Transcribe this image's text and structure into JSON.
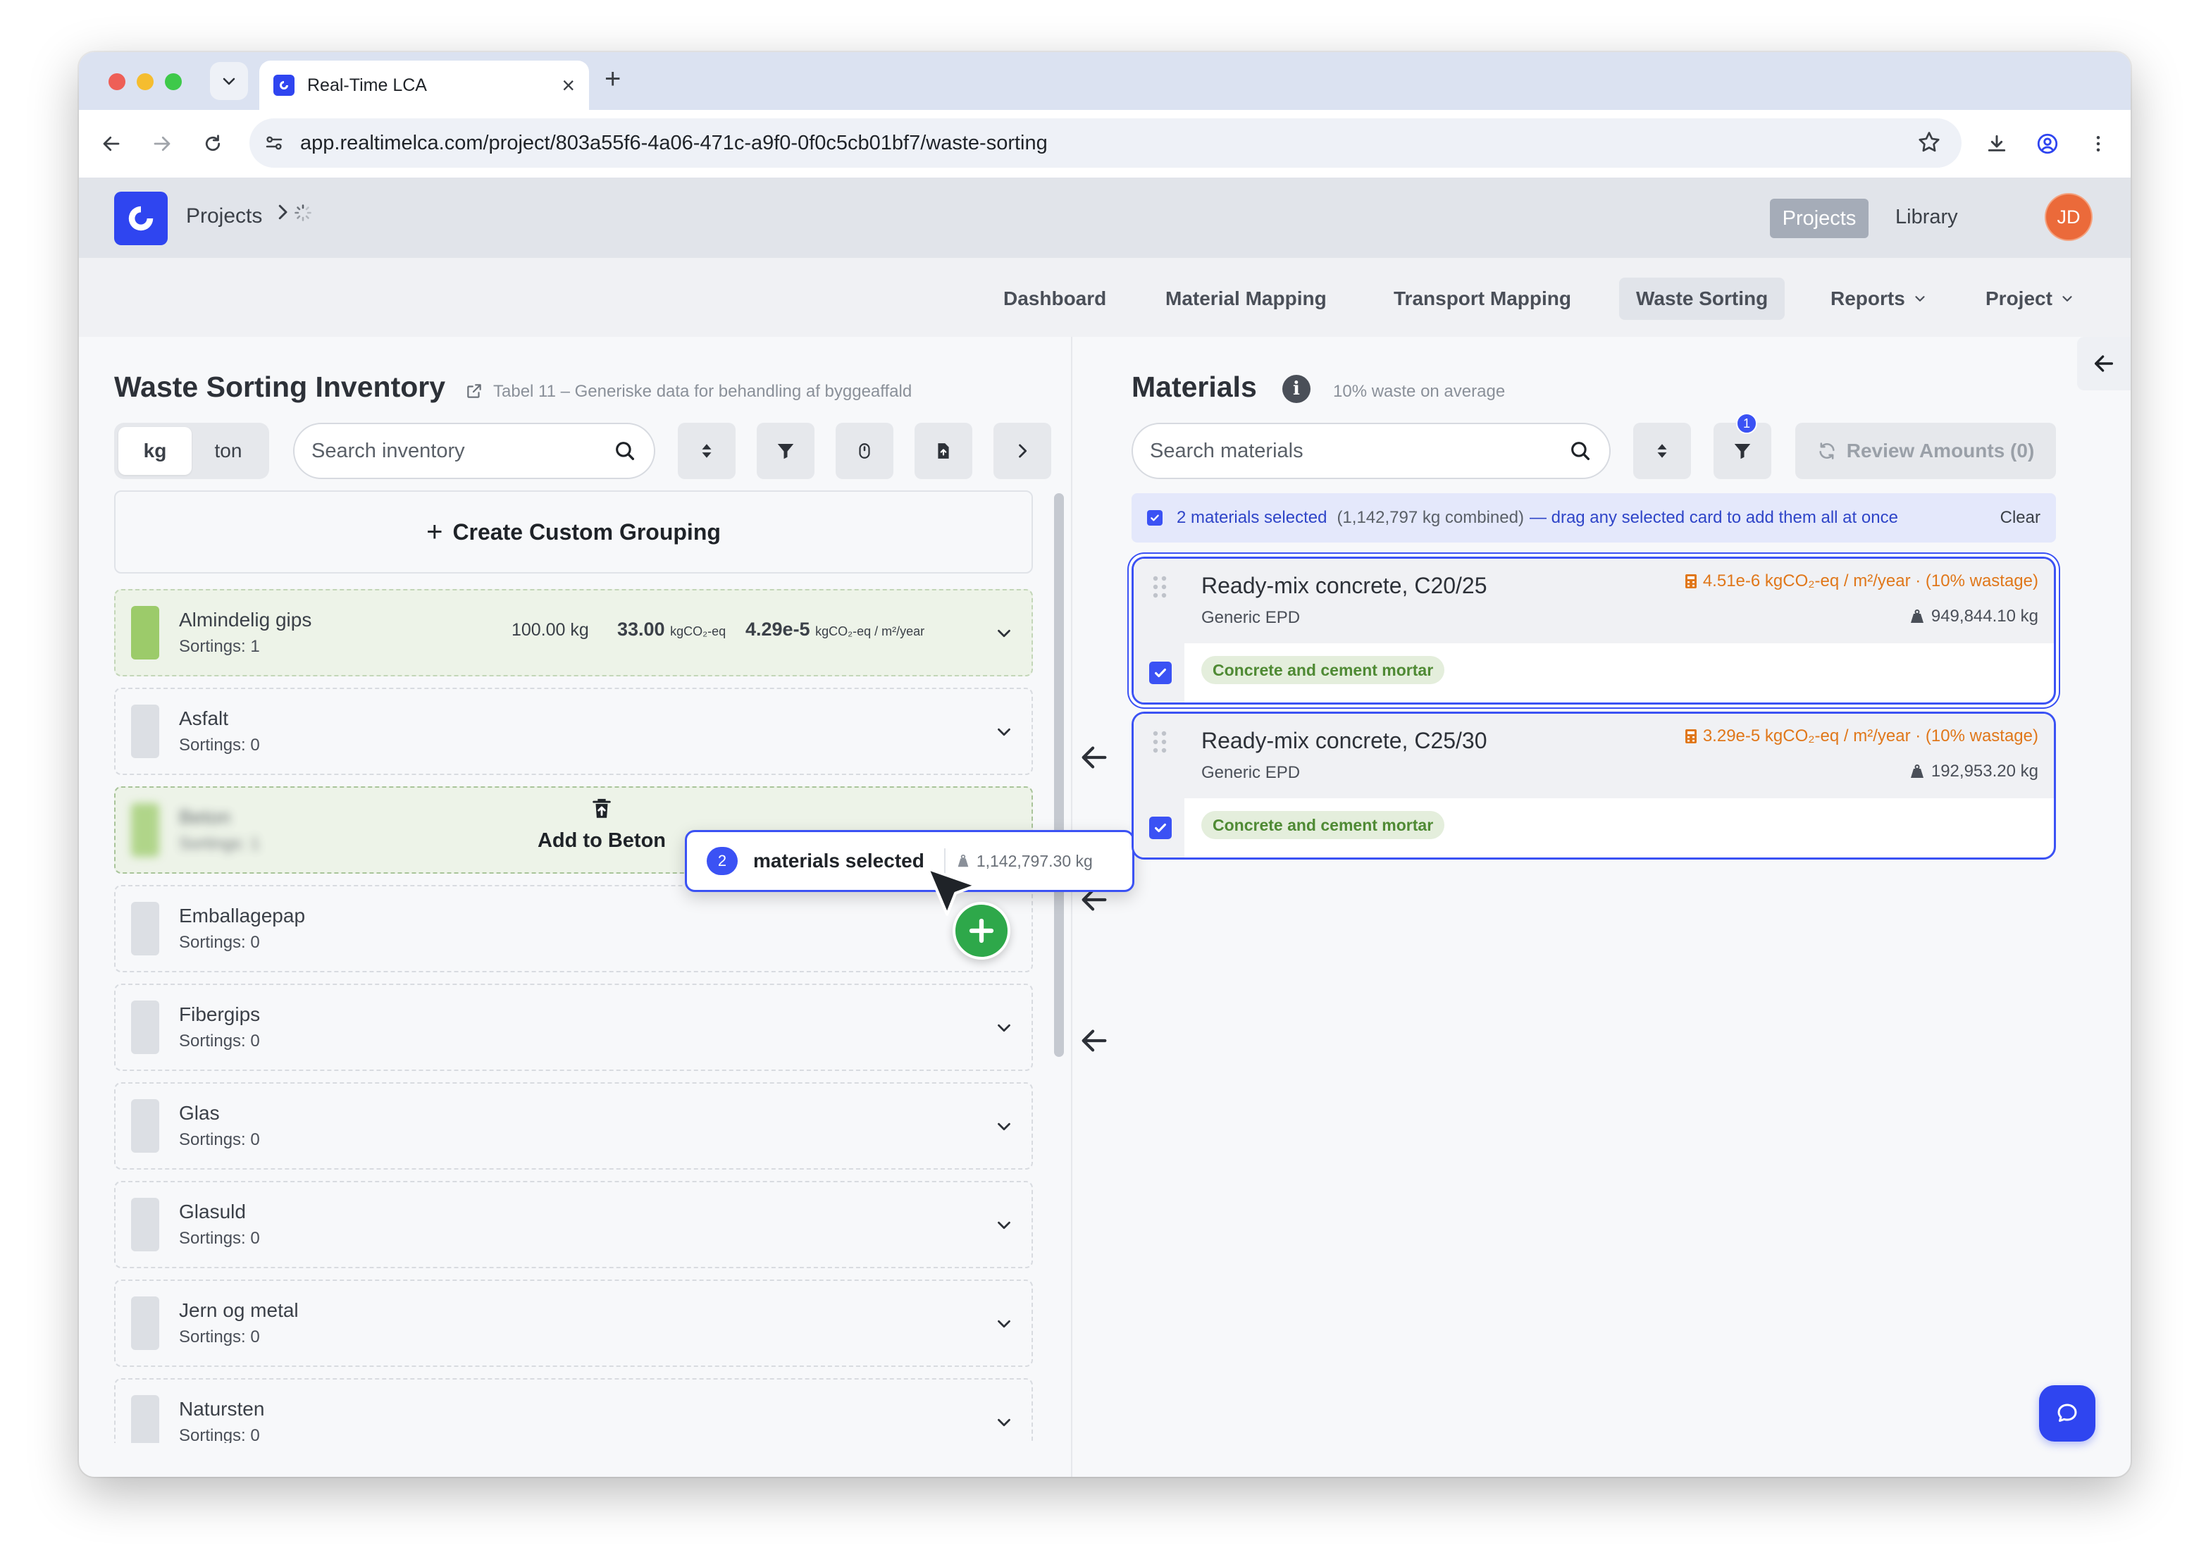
{
  "browser": {
    "tab_title": "Real-Time LCA",
    "url": "app.realtimelca.com/project/803a55f6-4a06-471c-a9f0-0f0c5cb01bf7/waste-sorting"
  },
  "header": {
    "breadcrumb_root": "Projects",
    "projects_button": "Projects",
    "library_link": "Library",
    "avatar_initials": "JD",
    "brand_color": "#2f45f0",
    "avatar_color": "#eb6a3a"
  },
  "nav": {
    "dashboard": "Dashboard",
    "material_mapping": "Material Mapping",
    "transport_mapping": "Transport Mapping",
    "waste_sorting": "Waste Sorting",
    "reports": "Reports",
    "project": "Project"
  },
  "inventory": {
    "title": "Waste Sorting Inventory",
    "source_link": "Tabel 11 – Generiske data for behandling af byggeaffald",
    "unit_kg": "kg",
    "unit_ton": "ton",
    "search_placeholder": "Search inventory",
    "create_grouping": "Create Custom Grouping",
    "drop_target_label": "Add to Beton",
    "groups": [
      {
        "name": "Almindelig gips",
        "sortings": "Sortings: 1",
        "amount": "100.00 kg",
        "co2_value": "33.00",
        "co2_unit": "kgCO₂-eq",
        "intensity_value": "4.29e-5",
        "intensity_unit": "kgCO₂-eq / m²/year"
      },
      {
        "name": "Asfalt",
        "sortings": "Sortings: 0"
      },
      {
        "name": "Beton",
        "sortings": "Sortings: 1"
      },
      {
        "name": "Emballagepap",
        "sortings": "Sortings: 0"
      },
      {
        "name": "Fibergips",
        "sortings": "Sortings: 0"
      },
      {
        "name": "Glas",
        "sortings": "Sortings: 0"
      },
      {
        "name": "Glasuld",
        "sortings": "Sortings: 0"
      },
      {
        "name": "Jern og metal",
        "sortings": "Sortings: 0"
      },
      {
        "name": "Natursten",
        "sortings": "Sortings: 0"
      }
    ]
  },
  "drag": {
    "count": "2",
    "label": "materials selected",
    "weight": "1,142,797.30 kg"
  },
  "materials": {
    "title": "Materials",
    "waste_note": "10% waste on average",
    "search_placeholder": "Search materials",
    "filter_badge": "1",
    "review_button": "Review Amounts (0)",
    "selection_bar": {
      "count_text": "2 materials selected",
      "combined_text": "(1,142,797 kg combined)",
      "hint_text": "— drag any selected card to add them all at once",
      "clear_text": "Clear"
    },
    "cards": [
      {
        "name": "Ready-mix concrete, C20/25",
        "source": "Generic EPD",
        "co2": "4.51e-6 kgCO₂-eq / m²/year · (10% wastage)",
        "weight": "949,844.10 kg",
        "tag": "Concrete and cement mortar"
      },
      {
        "name": "Ready-mix concrete, C25/30",
        "source": "Generic EPD",
        "co2": "3.29e-5 kgCO₂-eq / m²/year · (10% wastage)",
        "weight": "192,953.20 kg",
        "tag": "Concrete and cement mortar"
      }
    ]
  },
  "colors": {
    "accent": "#3b52f4",
    "co2_orange": "#e0771a",
    "tag_green": "#4f8a34",
    "swatch_green": "#9ccb6a",
    "add_green": "#2ea84a"
  }
}
